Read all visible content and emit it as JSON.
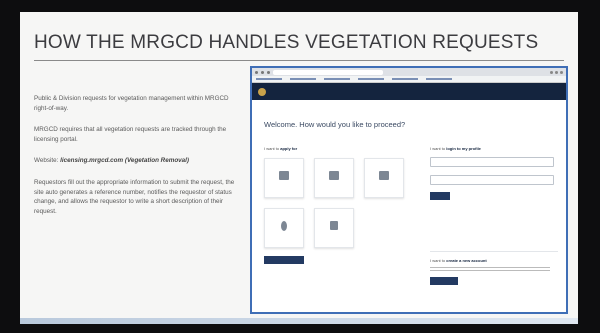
{
  "slide": {
    "title": "HOW THE MRGCD HANDLES VEGETATION REQUESTS",
    "paragraphs": {
      "p1": "Public & Division requests for vegetation management within MRGCD right-of-way.",
      "p2": "MRGCD requires that all vegetation requests are tracked through the licensing portal.",
      "p3_prefix": "Website: ",
      "p3_link": "licensing.mrgcd.com (Vegetation Removal)",
      "p4": "Requestors fill out the appropriate information to submit the request, the site auto generates a reference number, notifies the requestor of status change, and allows the requestor to write a short description of their request."
    }
  },
  "portal": {
    "welcome": "Welcome. How would you like to proceed?",
    "apply_prefix": "I want to ",
    "apply_bold": "apply for",
    "login_prefix": "I want to ",
    "login_bold": "login to my profile",
    "create_prefix": "I want to ",
    "create_bold": "create a new account",
    "icons": [
      "license-icon",
      "special-use-icon",
      "traffic-icon",
      "vegetation-icon",
      "facility-icon"
    ]
  },
  "colors": {
    "accent": "#3f6eb6",
    "appbar": "#14243e",
    "button": "#233a62"
  }
}
